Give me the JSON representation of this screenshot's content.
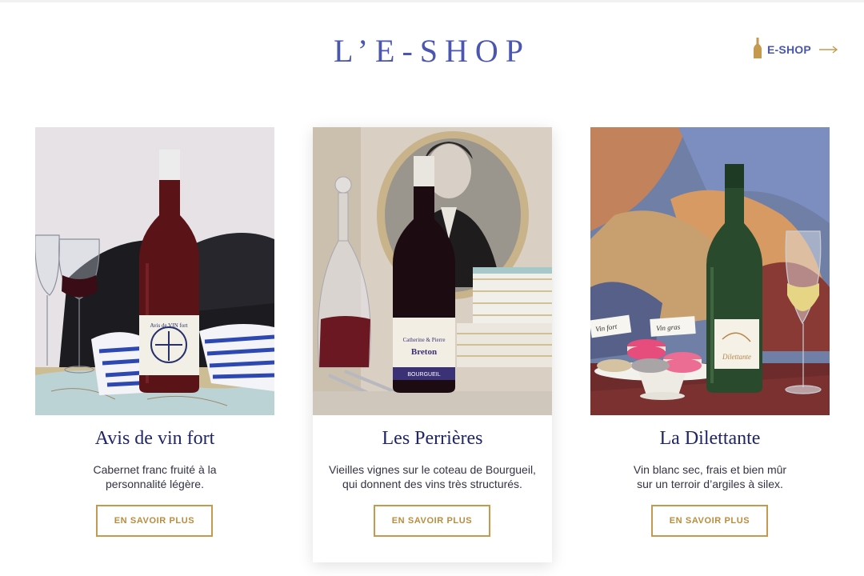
{
  "header": {
    "title": "L’E-SHOP",
    "eshop_link": {
      "label": "E-SHOP",
      "icon": "wine-bottle-icon",
      "arrow_icon": "arrow-right-icon"
    }
  },
  "colors": {
    "title_blue": "#4a56b0",
    "card_title_navy": "#1f2566",
    "gold": "#c59a4f"
  },
  "products": [
    {
      "title": "Avis de vin fort",
      "description_line1": "Cabernet franc fruité à la",
      "description_line2": "personnalité légère.",
      "button_label": "EN SAVOIR PLUS",
      "label_text": "Avis de VIN fort"
    },
    {
      "title": "Les Perrières",
      "description_line1": "Vieilles vignes sur le coteau de Bourgueil,",
      "description_line2": "qui donnent des vins très structurés.",
      "button_label": "EN SAVOIR PLUS",
      "label_text": "Catherine & Pierre Breton",
      "label_sub": "BOURGUEIL"
    },
    {
      "title": "La Dilettante",
      "description_line1": "Vin blanc sec, frais et bien mûr",
      "description_line2": "sur un terroir d’argiles à silex.",
      "button_label": "EN SAVOIR PLUS",
      "label_text": "Dilettante",
      "tag_1": "Vin fort",
      "tag_2": "Vin gras"
    }
  ]
}
